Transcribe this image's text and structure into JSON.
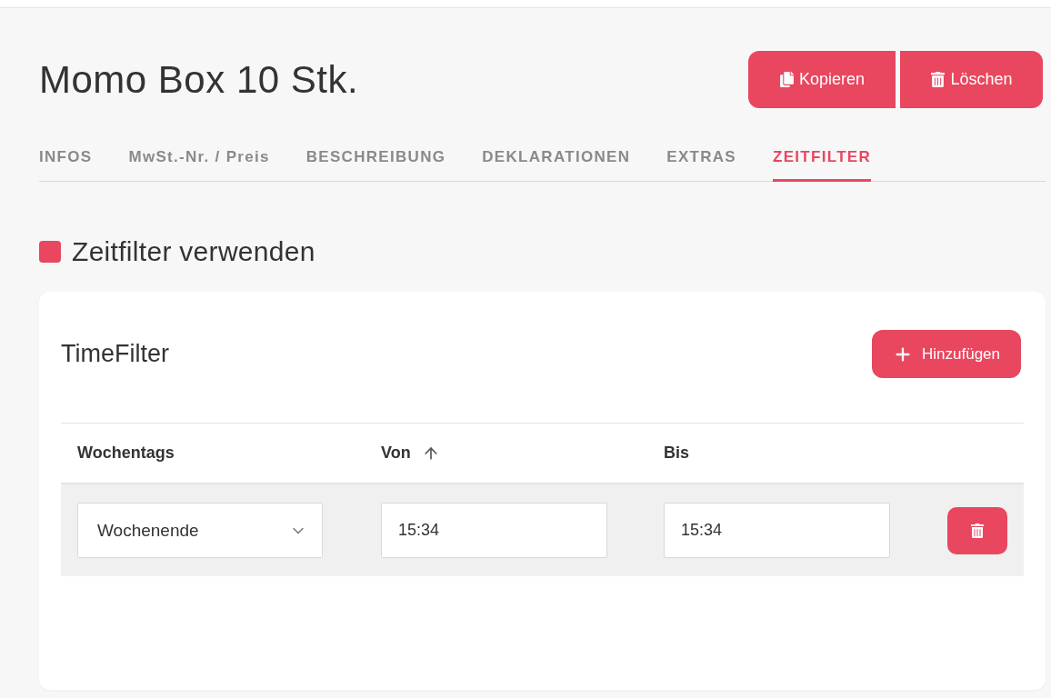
{
  "page": {
    "title": "Momo Box 10 Stk.",
    "actions": [
      {
        "kind": "copy",
        "label": "Kopieren"
      },
      {
        "kind": "delete",
        "label": "Löschen"
      }
    ]
  },
  "tabs": [
    {
      "label": "INFOS",
      "selected": false
    },
    {
      "label": "MwSt.-Nr. / Preis",
      "selected": false
    },
    {
      "label": "BESCHREIBUNG",
      "selected": false
    },
    {
      "label": "DEKLARATIONEN",
      "selected": false
    },
    {
      "label": "EXTRAS",
      "selected": false
    },
    {
      "label": "ZEITFILTER",
      "selected": true
    }
  ],
  "time_filter_toggle": {
    "label": "Zeitfilter verwenden",
    "checked": true
  },
  "card": {
    "title": "TimeFilter",
    "add_button": {
      "label": "Hinzufügen"
    },
    "table": {
      "columns": [
        {
          "label": "Wochentags",
          "sorted": false
        },
        {
          "label": "Von",
          "sorted": true
        },
        {
          "label": "Bis",
          "sorted": false
        }
      ],
      "rows": [
        {
          "weekday": "Wochenende",
          "from": "15:34",
          "to": "15:34"
        }
      ]
    }
  }
}
